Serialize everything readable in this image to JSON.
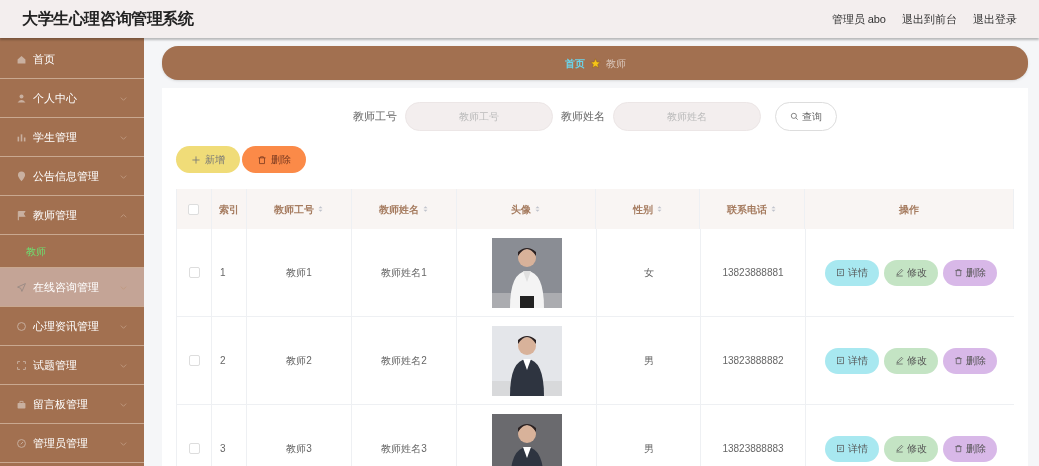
{
  "header": {
    "title": "大学生心理咨询管理系统",
    "links": [
      "管理员 abo",
      "退出到前台",
      "退出登录"
    ]
  },
  "sidebar": {
    "items": [
      {
        "label": "首页",
        "highlighted": false
      },
      {
        "label": "个人中心",
        "highlighted": false,
        "expanded": false
      },
      {
        "label": "学生管理",
        "highlighted": false,
        "expanded": false
      },
      {
        "label": "公告信息管理",
        "highlighted": false,
        "expanded": false
      },
      {
        "label": "教师管理",
        "highlighted": false,
        "expanded": true,
        "children": [
          {
            "label": "教师",
            "selected": true
          }
        ]
      },
      {
        "label": "在线咨询管理",
        "highlighted": true,
        "expanded": false
      },
      {
        "label": "心理资讯管理",
        "highlighted": false,
        "expanded": false
      },
      {
        "label": "试题管理",
        "highlighted": false,
        "expanded": false
      },
      {
        "label": "留言板管理",
        "highlighted": false,
        "expanded": false
      },
      {
        "label": "管理员管理",
        "highlighted": false,
        "expanded": false
      }
    ]
  },
  "breadcrumb": [
    "首页",
    "教师"
  ],
  "search": {
    "fields": [
      {
        "label": "教师工号",
        "placeholder": "教师工号"
      },
      {
        "label": "教师姓名",
        "placeholder": "教师姓名"
      }
    ],
    "button": "查询"
  },
  "actions": [
    {
      "label": "新增",
      "kind": "add"
    },
    {
      "label": "删除",
      "kind": "delete"
    }
  ],
  "table": {
    "select_all_checked": false,
    "columns": [
      {
        "label": "索引",
        "sortable": false
      },
      {
        "label": "教师工号",
        "sortable": true
      },
      {
        "label": "教师姓名",
        "sortable": true
      },
      {
        "label": "头像",
        "sortable": true
      },
      {
        "label": "性别",
        "sortable": true
      },
      {
        "label": "联系电话",
        "sortable": true
      },
      {
        "label": "操作",
        "sortable": false
      }
    ],
    "rows": [
      {
        "checked": false,
        "index": "1",
        "id": "教师1",
        "name": "教师姓名1",
        "gender": "女",
        "phone": "13823888881",
        "buttons": [
          {
            "label": "详情",
            "kind": "detail"
          },
          {
            "label": "修改",
            "kind": "edit"
          },
          {
            "label": "删除",
            "kind": "delete"
          }
        ]
      },
      {
        "checked": false,
        "index": "2",
        "id": "教师2",
        "name": "教师姓名2",
        "gender": "男",
        "phone": "13823888882",
        "buttons": [
          {
            "label": "详情",
            "kind": "detail"
          },
          {
            "label": "修改",
            "kind": "edit"
          },
          {
            "label": "删除",
            "kind": "delete"
          }
        ]
      },
      {
        "checked": false,
        "index": "3",
        "id": "教师3",
        "name": "教师姓名3",
        "gender": "男",
        "phone": "13823888883",
        "buttons": [
          {
            "label": "详情",
            "kind": "detail"
          },
          {
            "label": "修改",
            "kind": "edit"
          },
          {
            "label": "删除",
            "kind": "delete"
          }
        ]
      }
    ]
  }
}
